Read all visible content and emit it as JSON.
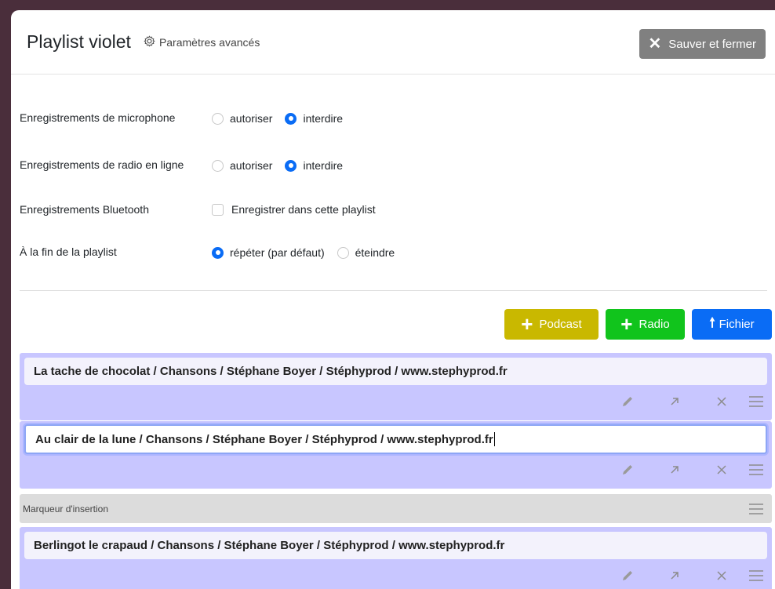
{
  "header": {
    "title": "Playlist violet",
    "advanced_label": "Paramètres avancés",
    "save_label": "Sauver et fermer"
  },
  "settings": {
    "mic": {
      "label": "Enregistrements de microphone",
      "opt1": "autoriser",
      "opt2": "interdire",
      "selected": "interdire"
    },
    "radio": {
      "label": "Enregistrements de radio en ligne",
      "opt1": "autoriser",
      "opt2": "interdire",
      "selected": "interdire"
    },
    "bluetooth": {
      "label": "Enregistrements Bluetooth",
      "checkbox_label": "Enregistrer dans cette playlist",
      "checked": false
    },
    "end": {
      "label": "À la fin de la playlist",
      "opt1": "répéter (par défaut)",
      "opt2": "éteindre",
      "selected": "répéter (par défaut)"
    }
  },
  "buttons": {
    "podcast": "Podcast",
    "radio": "Radio",
    "fichier": "Fichier"
  },
  "tracks": [
    {
      "title": "La tache de chocolat / Chansons / Stéphane Boyer / Stéphyprod / www.stephyprod.fr"
    },
    {
      "title": "Au clair de la lune / Chansons / Stéphane Boyer / Stéphyprod / www.stephyprod.fr"
    },
    {
      "title": "Berlingot le crapaud / Chansons / Stéphane Boyer / Stéphyprod / www.stephyprod.fr"
    }
  ],
  "marker": {
    "label": "Marqueur d'insertion"
  },
  "icons": {
    "edit": "pencil-icon",
    "move": "arrow-up-right-icon",
    "delete": "close-icon",
    "drag": "drag-handle-icon",
    "settings": "gear-icon"
  },
  "colors": {
    "accent": "#0a6cf5",
    "track_bg": "#c8c6ff",
    "podcast": "#c9b800",
    "radio": "#11c41c",
    "save": "#808080"
  }
}
